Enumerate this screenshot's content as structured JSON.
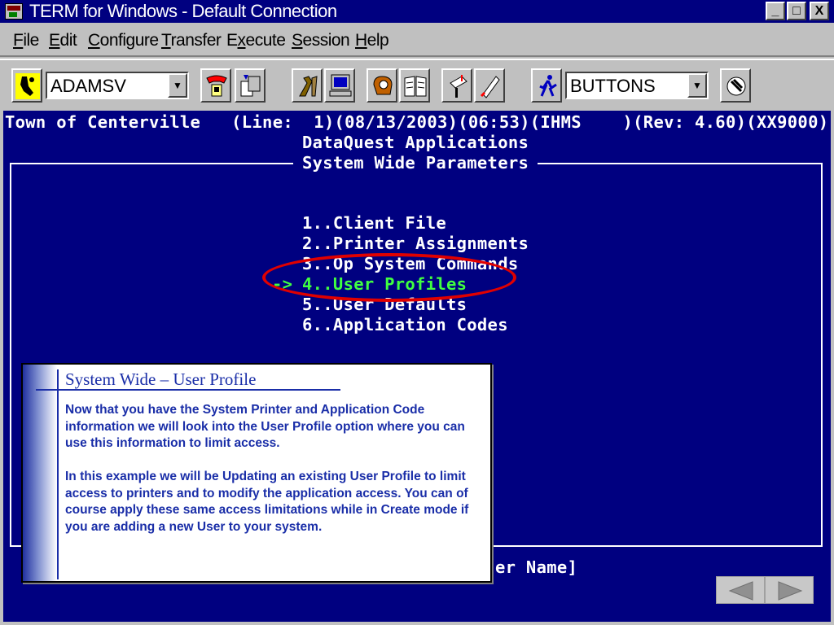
{
  "window": {
    "title": "TERM for Windows - Default Connection",
    "min_label": "_",
    "max_label": "□",
    "close_label": "X"
  },
  "menu": [
    {
      "label": "File",
      "u": "F",
      "rest": "ile"
    },
    {
      "label": "Edit",
      "u": "E",
      "rest": "dit"
    },
    {
      "label": "Configure",
      "u": "C",
      "rest": "onfigure"
    },
    {
      "label": "Transfer",
      "u": "T",
      "rest": "ransfer"
    },
    {
      "label": "Execute",
      "pre": "E",
      "u": "x",
      "rest": "ecute"
    },
    {
      "label": "Session",
      "u": "S",
      "rest": "ession"
    },
    {
      "label": "Help",
      "u": "H",
      "rest": "elp"
    }
  ],
  "toolbar": {
    "user_combo": "ADAMSV",
    "buttons_combo": "BUTTONS"
  },
  "terminal": {
    "header_line": "Town of Centerville   (Line:  1)(08/13/2003)(06:53)(IHMS    )(Rev: 4.60)(XX9000)",
    "app_title": "DataQuest Applications",
    "section_title": "System Wide Parameters",
    "options": [
      "1..Client File",
      "2..Printer Assignments",
      "3..Op System Commands",
      "4..User Profiles",
      "5..User Defaults",
      "6..Application Codes"
    ],
    "selector": "->",
    "footer_fragment": "er Name]"
  },
  "callout": {
    "title": "System Wide – User Profile",
    "paragraph1": "Now that you have the System Printer and Application Code information we will look into the User Profile option where you can use this information to limit access.",
    "paragraph2": "In this example we will be Updating an existing User Profile to limit access to printers and to modify the application access.   You can of course apply these same access limitations while in Create mode if you are adding a new User to your system."
  },
  "colors": {
    "terminal_bg": "#000080",
    "terminal_text": "#ffffff",
    "selected_option": "#40ff40",
    "highlight_ring": "#e00000",
    "callout_text": "#1a2ea8"
  },
  "icons": [
    "term-app-icon",
    "binoculars-icon",
    "phone-icon",
    "copy-icon",
    "tools-icon",
    "computer-icon",
    "mitt-icon",
    "book-icon",
    "mailbox-icon",
    "pen-icon",
    "runner-icon",
    "script-icon",
    "triangle-left-icon",
    "triangle-right-icon"
  ]
}
